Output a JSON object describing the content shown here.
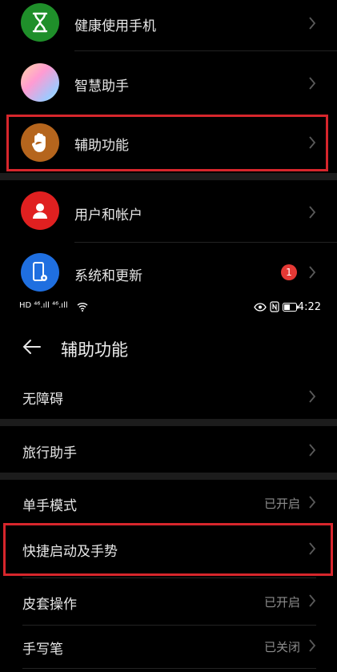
{
  "top_list": {
    "items": [
      {
        "label": "健康使用手机",
        "icon": "hourglass-icon"
      },
      {
        "label": "智慧助手",
        "icon": "assistant-gradient-icon"
      },
      {
        "label": "辅助功能",
        "icon": "hand-icon"
      },
      {
        "label": "用户和帐户",
        "icon": "user-icon"
      },
      {
        "label": "系统和更新",
        "icon": "phone-settings-icon",
        "badge": "1"
      }
    ]
  },
  "status_bar": {
    "left_icons": "HD ⁴⁶.ıll ⁴⁶.ıll",
    "time": "4:22",
    "right_icons": "eye-nfc-battery"
  },
  "accessibility_page": {
    "title": "辅助功能",
    "items": [
      {
        "label": "无障碍",
        "status": ""
      },
      {
        "label": "旅行助手",
        "status": ""
      },
      {
        "label": "单手模式",
        "status": "已开启"
      },
      {
        "label": "快捷启动及手势",
        "status": ""
      },
      {
        "label": "皮套操作",
        "status": "已开启"
      },
      {
        "label": "手写笔",
        "status": "已关闭"
      }
    ]
  },
  "colors": {
    "highlight": "#d7262c",
    "hourglass": "#1f8f2a",
    "hand": "#b5651d",
    "user": "#e02020",
    "system": "#1f6fe0",
    "badge": "#e53935"
  }
}
